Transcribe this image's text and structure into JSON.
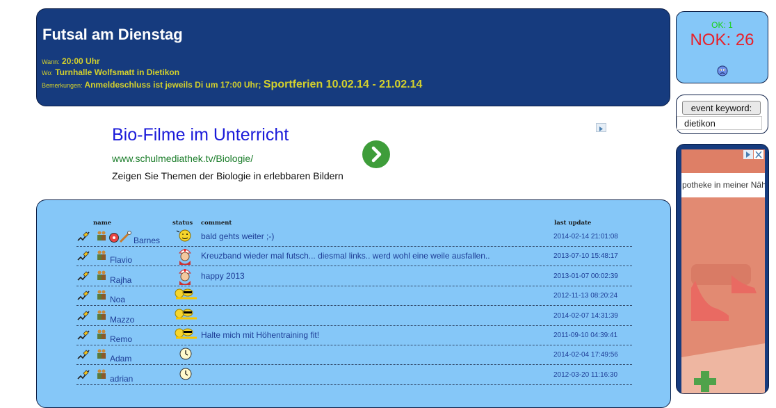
{
  "event": {
    "title": "Futsal am Dienstag",
    "when_label": "Wann:",
    "when_value": "20:00 Uhr",
    "where_label": "Wo:",
    "where_value": "Turnhalle Wolfsmatt in Dietikon",
    "notes_label": "Bemerkungen:",
    "notes_value": "Anmeldeschluss ist jeweils Di um 17:00 Uhr;",
    "notes_highlight": "Sportferien 10.02.14 - 21.02.14"
  },
  "status_box": {
    "ok": "OK: 1",
    "nok": "NOK: 26",
    "smiley_icon": "sad-face-icon"
  },
  "keyword": {
    "button_label": "event keyword:",
    "value": "dietikon"
  },
  "ad": {
    "title": "Bio-Filme im Unterricht",
    "url": "www.schulmediathek.tv/Biologie/",
    "text": "Zeigen Sie Themen der Biologie in erlebbaren Bildern"
  },
  "table": {
    "headers": {
      "name": "name",
      "status": "status",
      "comment": "comment",
      "last_update": "last update"
    },
    "rows": [
      {
        "name": "Barnes",
        "status": "wink-smiley",
        "comment": "bald gehts weiter ;-)",
        "last_update": "2014-02-14 21:01:08"
      },
      {
        "name": "Flavio",
        "status": "nurse-smiley",
        "comment": "Kreuzband wieder mal futsch... diesmal links.. werd wohl eine weile ausfallen..",
        "last_update": "2013-07-10 15:48:17"
      },
      {
        "name": "Rajha",
        "status": "nurse-smiley",
        "comment": "happy 2013",
        "last_update": "2013-01-07 00:02:39"
      },
      {
        "name": "Noa",
        "status": "sunbathing-smiley",
        "comment": "",
        "last_update": "2012-11-13 08:20:24"
      },
      {
        "name": "Mazzo",
        "status": "sunbathing-smiley",
        "comment": "",
        "last_update": "2014-02-07 14:31:39"
      },
      {
        "name": "Remo",
        "status": "sunbathing-smiley",
        "comment": "Halte mich mit Höhentraining fit!",
        "last_update": "2011-09-10 04:39:41"
      },
      {
        "name": "Adam",
        "status": "clock-smiley",
        "comment": "",
        "last_update": "2014-02-04 17:49:56"
      },
      {
        "name": "adrian",
        "status": "clock-smiley",
        "comment": "",
        "last_update": "2012-03-20 11:16:30"
      }
    ]
  },
  "side_ad": {
    "text": "potheke in meiner Näh"
  },
  "colors": {
    "header_bg": "#163b7e",
    "panel_bg": "#85c7f8",
    "accent_yellow": "#d4d12c",
    "ok_green": "#19d119",
    "nok_red": "#e8202a"
  }
}
